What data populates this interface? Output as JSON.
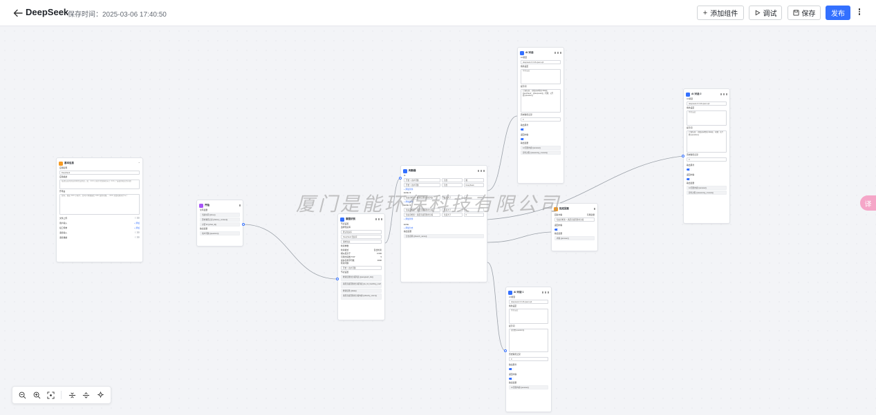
{
  "header": {
    "title": "DeepSeek",
    "save_time": "保存时间：2025-03-06 17:40:50",
    "add_component": "添加组件",
    "debug": "调试",
    "save": "保存",
    "publish": "发布"
  },
  "watermark": "厦门是能环保科技有限公司",
  "side_tab": "译",
  "colors": {
    "accent": "#3370ff",
    "start": "#f59a23",
    "classify": "#a855f7",
    "ai": "#3370ff"
  },
  "nodes": {
    "base": {
      "title": "基本信息",
      "app_name_label": "应用名称",
      "app_name": "DeepSeek",
      "app_desc_label": "应用描述",
      "app_desc": "描述该应用的应用场景及用途，如：XXX 小助手帮您解答关于 XXX 产品使用和业务问题",
      "welcome_label": "开场白",
      "welcome": "您好，我是 XXX 小助手，您可以向我提出 XXX 使用问题。- XXX 主要功能有什么？",
      "rows": [
        "文件上传",
        "用户输入",
        "接口传参",
        "语音输入",
        "语音播放"
      ],
      "set": "+ 添加"
    },
    "start": {
      "title": "开始",
      "section": "全局变量",
      "fields": [
        "当前时间 {{time}}",
        "历史聊天记录 {{history_context}}",
        "对话 ID {{chat_id}}"
      ],
      "out_label": "输出变量",
      "out": "用户问题 {{question}}"
    },
    "classify": {
      "title": "意图识别",
      "section": "节点设置",
      "q_label": "选择知识库",
      "items": [
        "默认知识库",
        "DeepSeek 知识库",
        "通用知识"
      ],
      "params_label": "检索参数",
      "params": [
        [
          "检索模式",
          "混合检索"
        ],
        [
          "相似度高于",
          "0.600"
        ],
        [
          "引用分段数 TOP",
          "5"
        ],
        [
          "最多引用字符数",
          "3000"
        ]
      ],
      "q2_label": "检索问题",
      "q2": "开始 > 用户问题",
      "outs": [
        "检索结果的分段列表 {{paragraph_list}}",
        "满足直接回答的分段列表 {{is_hit_handling_method_list}}",
        "检索结果 {{data}}",
        "满足直接回答的分段内容 {{directly_return}}"
      ]
    },
    "branch": {
      "title": "判断器",
      "rows": [
        [
          "开始 > 用户问题",
          "包含",
          "图"
        ],
        [
          "开始 > 用户问题",
          "包含",
          "DeepSeek"
        ]
      ],
      "add": "+ 添加条件",
      "elseif_label": "ELSE IF",
      "rows2": [
        [
          "知识库检索 > 检索结果的分段列表",
          "长度大于",
          "0"
        ]
      ],
      "rows3": [
        [
          "知识库检索 > 满足直接回答的分段",
          "长度大于",
          "0"
        ],
        [
          "知识库检索 > 满足直接回答的分段",
          "长度大于",
          "0"
        ]
      ],
      "else_label": "ELSE",
      "add_branch": "+ 添加分支",
      "out_label": "输出变量",
      "out": "分支名称 {{branch_name}}"
    },
    "ai1": {
      "title": "AI 对话",
      "model_label": "AI 模型",
      "model": "deepseek-r1:14b-qwen-q4",
      "role_label": "角色设定",
      "role": "角色设定",
      "prompt_label": "提示词",
      "prompt": "已知信息：{{知识库检索.data}}；DeepSeek：{{deepseek}}；问题：{{开始.question}}",
      "history_label": "历史聊天记录",
      "history": "0",
      "ret_label": "返回内容",
      "think_label": "输出思考",
      "out_label": "输出变量",
      "outs": [
        "AI 回答内容 {{answer}}",
        "思考过程 {{reasoning_content}}"
      ]
    },
    "ai2": {
      "title": "AI 对话 2",
      "model_label": "AI 模型",
      "model": "deepseek-r1:14b-qwen-q4",
      "role_label": "角色设定",
      "role": "角色设定",
      "prompt_label": "提示词",
      "prompt": "已知信息：{{知识库检索.data}}；问题：{{开始.question}}",
      "history_label": "历史聊天记录",
      "history": "0",
      "ret_label": "返回内容",
      "think_label": "输出思考",
      "out_label": "输出变量",
      "outs": [
        "AI 回答内容 {{answer}}",
        "思考过程 {{reasoning_content}}"
      ]
    },
    "direct": {
      "title": "指定回复",
      "reply_label": "回复内容",
      "reply_mode": "引用变量",
      "reply": "知识库检索 > 满足直接回答的分段",
      "ret_label": "返回内容",
      "out_label": "输出变量",
      "out": "内容 {{answer}}"
    },
    "ai3": {
      "title": "AI 对话 1",
      "model_label": "AI 模型",
      "model": "deepseek-r1:14b-qwen-q4",
      "role_label": "角色设定",
      "role": "角色设定",
      "prompt_label": "提示词",
      "prompt": "{{开始.question}}",
      "history_label": "历史聊天记录",
      "history": "0",
      "ret_label": "返回内容",
      "think_label": "输出思考",
      "out_label": "输出变量",
      "outs": [
        "AI 回答内容 {{answer}}"
      ]
    }
  }
}
